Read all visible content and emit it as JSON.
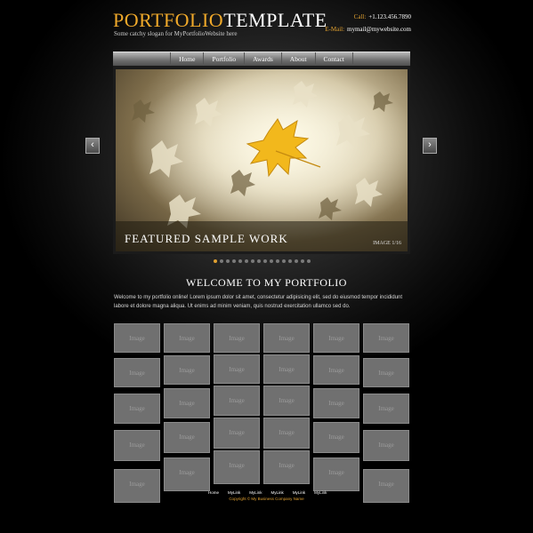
{
  "header": {
    "logo_part1": "PORTFOLIO",
    "logo_part2": "TEMPLATE",
    "slogan": "Some catchy slogan for MyPortfolioWebsite here",
    "call_label": "Call:",
    "call_value": "+1.123.456.7890",
    "email_label": "E-Mail:",
    "email_value": "mymail@mywebsite.com"
  },
  "nav": {
    "items": [
      "Home",
      "Portfolio",
      "Awards",
      "About",
      "Contact"
    ]
  },
  "slider": {
    "caption_title": "FEATURED SAMPLE WORK",
    "counter": "IMAGE 1/16",
    "prev_glyph": "‹",
    "next_glyph": "›",
    "dot_count": 16,
    "active_dot": 1
  },
  "welcome": {
    "title": "WELCOME TO MY PORTFOLIO",
    "text": "Welcome to my portfolio online! Lorem ipsum dolor sit amet, consectetur adipisicing elit, sed do eiusmod tempor incididunt labore et dolore magna aliqua. Ut enims ad minim veniam, quis nostrud exercitation ullamco  sed do."
  },
  "gallery": {
    "rows": 5,
    "columns": 6,
    "tile_label": "Image"
  },
  "footer": {
    "links": [
      "Home",
      "MyLink",
      "MyLink",
      "MyLink",
      "MyLink",
      "MyLink"
    ],
    "copyright": "Copyright © My Business Company Name"
  },
  "colors": {
    "accent": "#e0a030",
    "tile": "#707070",
    "background": "#000000"
  }
}
